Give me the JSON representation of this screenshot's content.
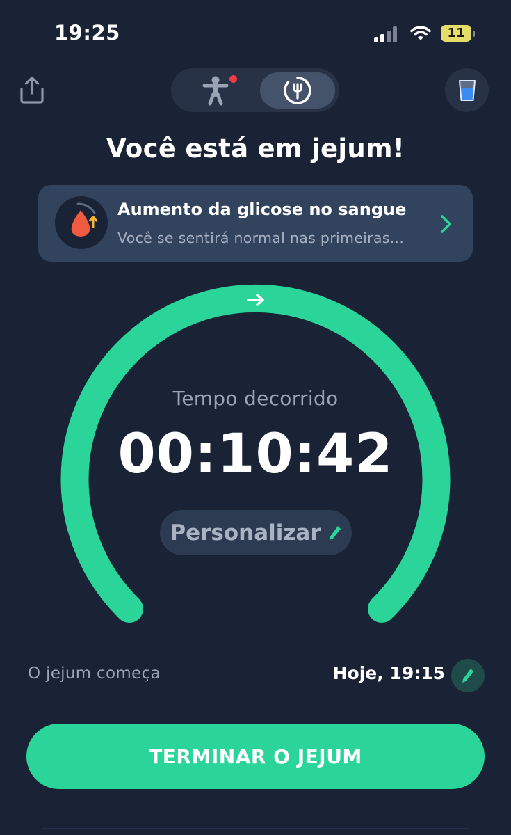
{
  "status_bar": {
    "time": "19:25",
    "battery": "11"
  },
  "header": {
    "title": "Você está em jejum!"
  },
  "info_card": {
    "title": "Aumento da glicose no sangue",
    "subtitle": "Você se sentirá normal nas primeiras..."
  },
  "timer": {
    "label": "Tempo decorrido",
    "elapsed": "00:10:42",
    "customize_label": "Personalizar"
  },
  "start_row": {
    "label": "O jejum começa",
    "value": "Hoje, 19:15"
  },
  "end_button": {
    "label": "TERMINAR O JEJUM"
  },
  "icons": [
    "share-icon",
    "body-figure-icon",
    "fasting-clock-fork-icon",
    "water-glass-icon",
    "blood-drop-icon",
    "chevron-right-icon",
    "arrow-right-icon",
    "pencil-icon"
  ],
  "colors": {
    "background": "#1a2335",
    "accent": "#2bd59a",
    "card": "#32435e",
    "notification": "#f03a45",
    "drop": "#f05a40",
    "battery": "#e5dd6a"
  }
}
